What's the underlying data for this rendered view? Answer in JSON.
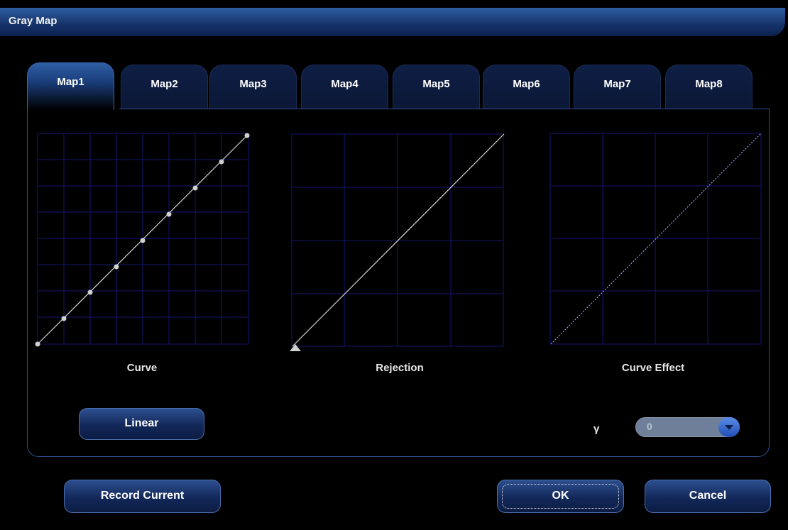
{
  "window": {
    "title": "Gray Map"
  },
  "tabs": [
    {
      "label": "Map1",
      "active": true
    },
    {
      "label": "Map2",
      "active": false
    },
    {
      "label": "Map3",
      "active": false
    },
    {
      "label": "Map4",
      "active": false
    },
    {
      "label": "Map5",
      "active": false
    },
    {
      "label": "Map6",
      "active": false
    },
    {
      "label": "Map7",
      "active": false
    },
    {
      "label": "Map8",
      "active": false
    }
  ],
  "charts": {
    "curve": {
      "label": "Curve"
    },
    "rejection": {
      "label": "Rejection"
    },
    "effect": {
      "label": "Curve Effect"
    }
  },
  "buttons": {
    "linear": "Linear",
    "record_current": "Record Current",
    "ok": "OK",
    "cancel": "Cancel"
  },
  "gamma": {
    "label": "γ",
    "value": "0"
  },
  "colors": {
    "grid": "#16166e",
    "curve": "#d8d8d8",
    "effect": "#8f9bff",
    "accent": "#2f5fa4"
  }
}
